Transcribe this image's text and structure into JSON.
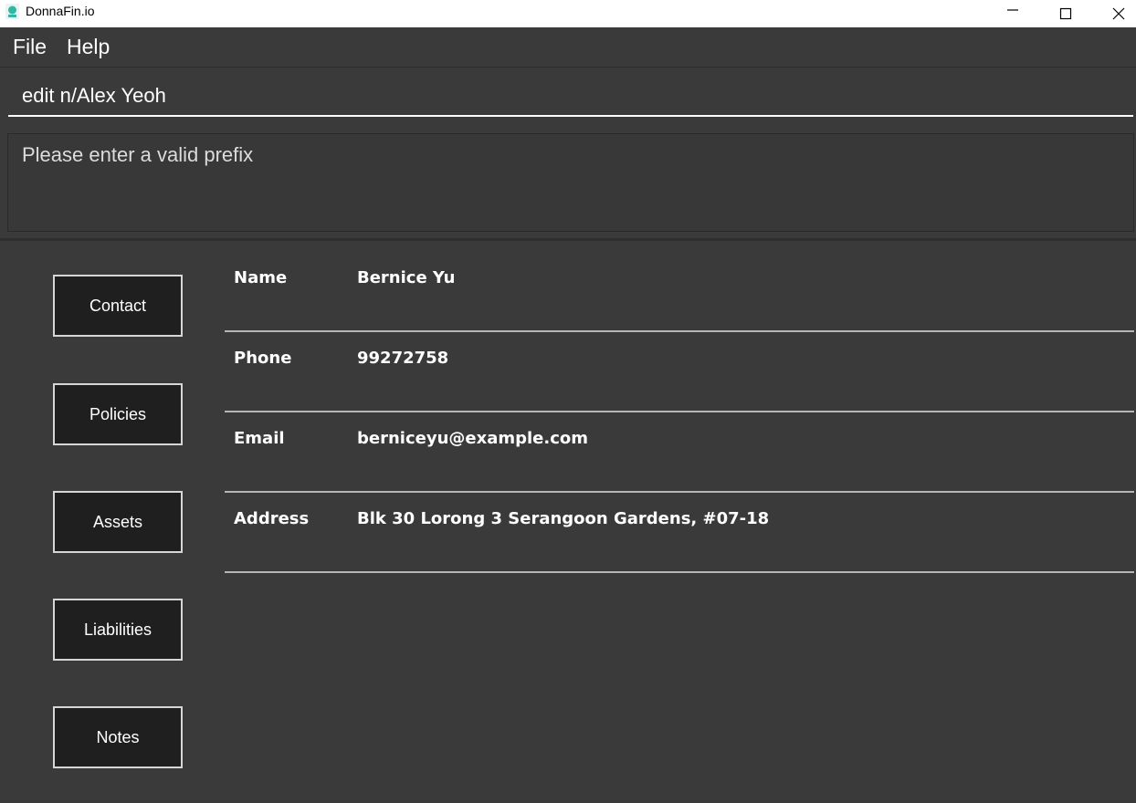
{
  "window": {
    "title": "DonnaFin.io",
    "app_icon": "donnafin-logo-icon"
  },
  "menu": {
    "file": "File",
    "help": "Help"
  },
  "command": {
    "value": "edit n/Alex Yeoh"
  },
  "result": {
    "message": "Please enter a valid prefix"
  },
  "tabs": [
    {
      "label": "Contact"
    },
    {
      "label": "Policies"
    },
    {
      "label": "Assets"
    },
    {
      "label": "Liabilities"
    },
    {
      "label": "Notes"
    }
  ],
  "details": [
    {
      "label": "Name",
      "value": "Bernice Yu"
    },
    {
      "label": "Phone",
      "value": "99272758"
    },
    {
      "label": "Email",
      "value": "berniceyu@example.com"
    },
    {
      "label": "Address",
      "value": "Blk 30 Lorong 3 Serangoon Gardens, #07-18"
    }
  ],
  "colors": {
    "background": "#3a3a3a",
    "tab_button_bg": "#1f1f1f",
    "accent_icon": "#2fb8a6"
  }
}
